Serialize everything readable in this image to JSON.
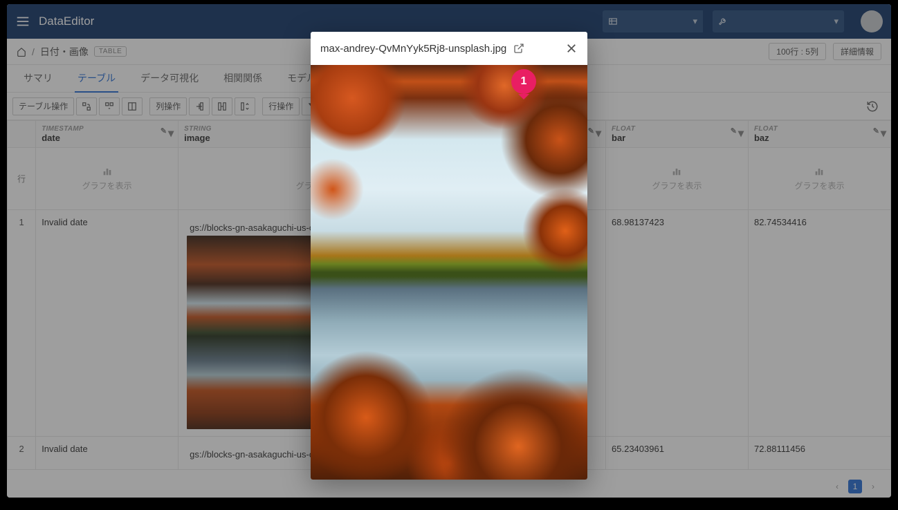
{
  "app": {
    "title": "DataEditor"
  },
  "breadcrumb": {
    "page": "日付・画像",
    "badge": "TABLE"
  },
  "status": {
    "rowcol": "100行 : 5列",
    "detail": "詳細情報"
  },
  "tabs": {
    "summary": "サマリ",
    "table": "テーブル",
    "viz": "データ可視化",
    "corr": "相関関係",
    "model": "モデル作成"
  },
  "toolbar": {
    "table_ops": "テーブル操作",
    "col_ops": "列操作",
    "row_ops": "行操作"
  },
  "columns": {
    "row_label": "行",
    "date": {
      "type": "TIMESTAMP",
      "name": "date"
    },
    "image": {
      "type": "STRING",
      "name": "image"
    },
    "bar": {
      "type": "FLOAT",
      "name": "bar"
    },
    "baz": {
      "type": "FLOAT",
      "name": "baz"
    }
  },
  "graph_placeholder": "グラフを表示",
  "rows": [
    {
      "idx": "1",
      "date": "Invalid date",
      "image": "gs://blocks-gn-asakaguchi-us-cent ... lash.jpg",
      "bar": "68.98137423",
      "baz": "82.74534416"
    },
    {
      "idx": "2",
      "date": "Invalid date",
      "image": "gs://blocks-gn-asakaguchi-us-cent",
      "bar": "65.23403961",
      "baz": "72.88111456"
    }
  ],
  "pagination": {
    "current": "1"
  },
  "modal": {
    "filename": "max-andrey-QvMnYyk5Rj8-unsplash.jpg",
    "pin": "1"
  }
}
